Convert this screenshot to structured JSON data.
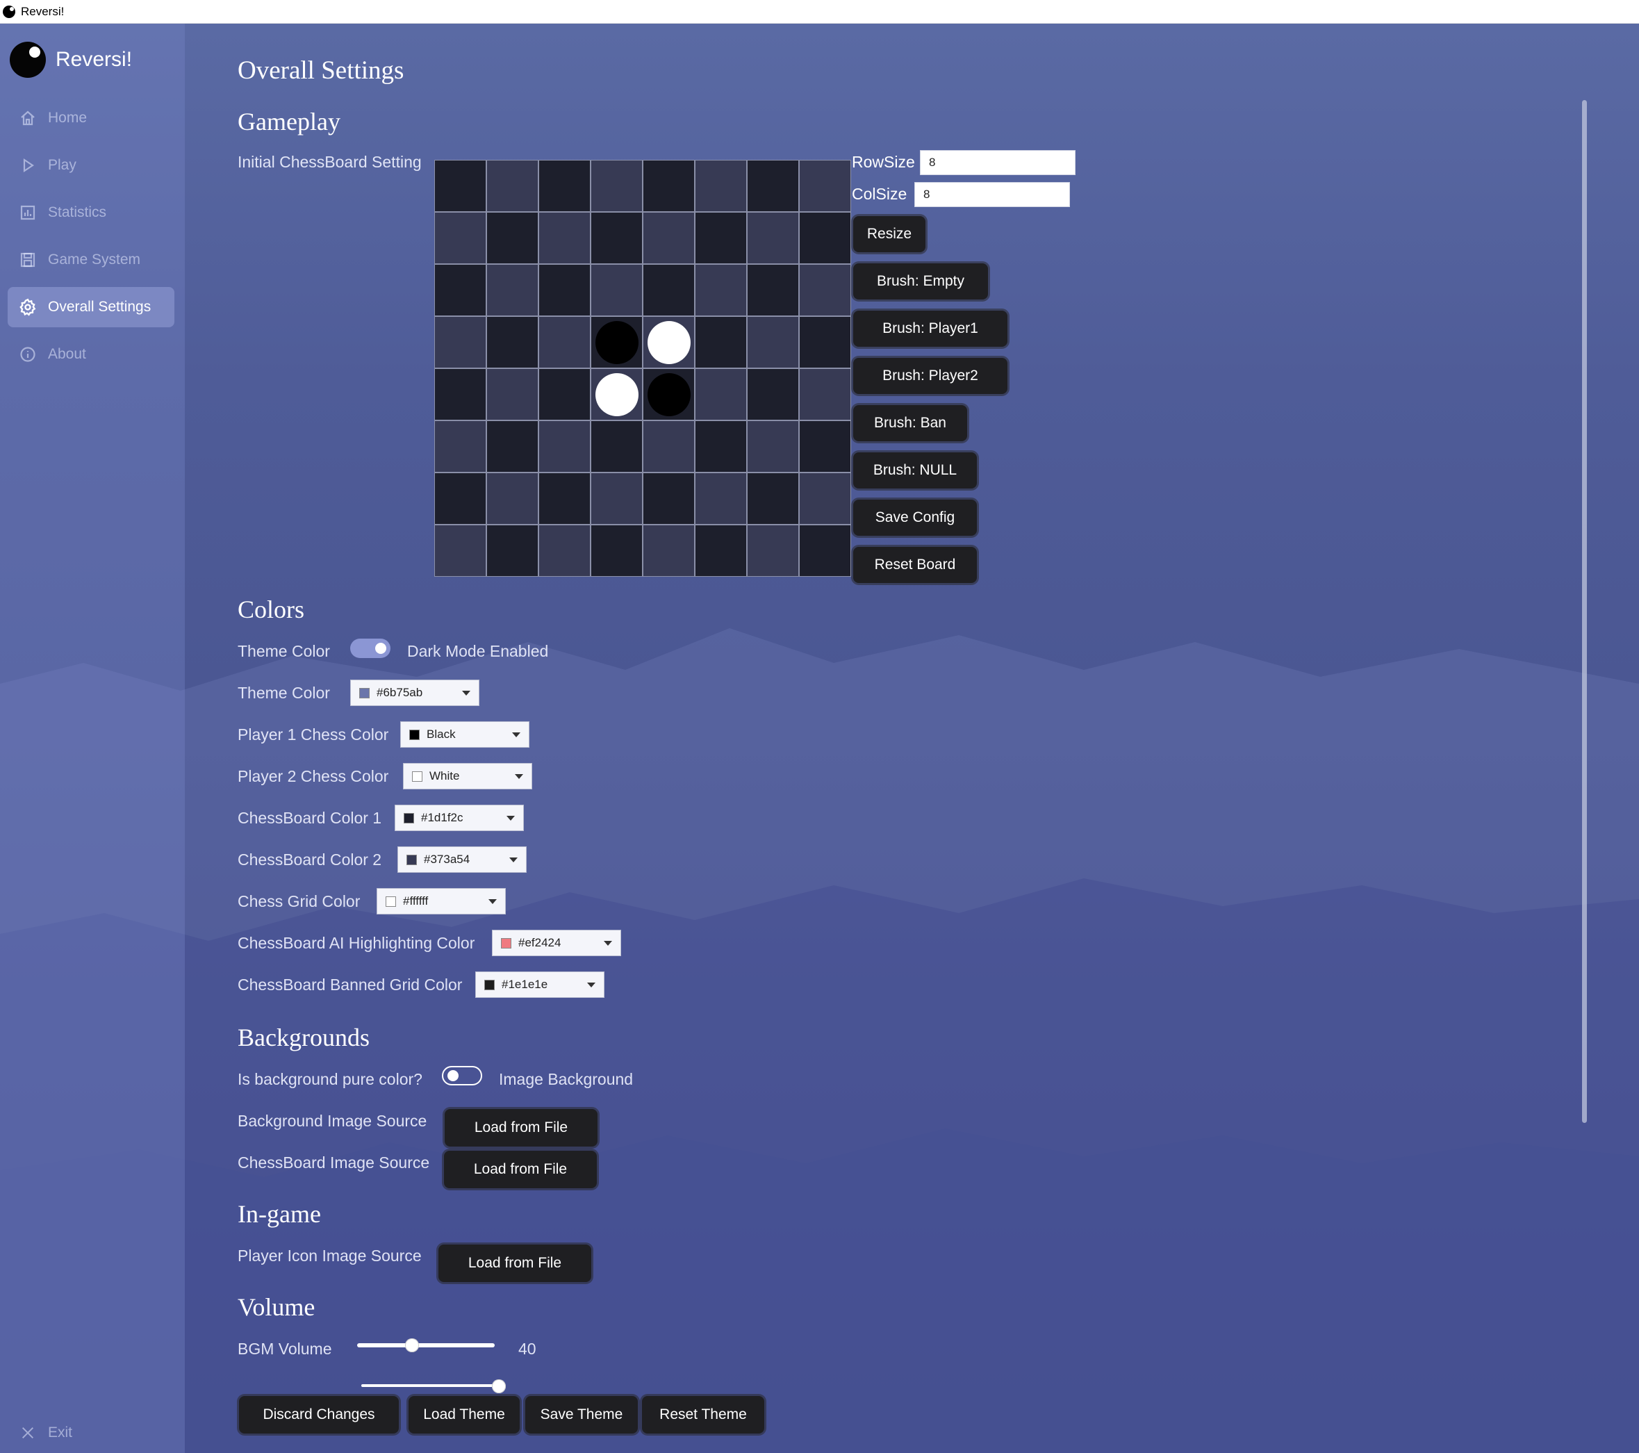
{
  "window": {
    "title": "Reversi!"
  },
  "brand": {
    "name": "Reversi!"
  },
  "sidebar": {
    "items": [
      {
        "label": "Home",
        "icon": "home-icon"
      },
      {
        "label": "Play",
        "icon": "play-icon"
      },
      {
        "label": "Statistics",
        "icon": "chart-icon"
      },
      {
        "label": "Game System",
        "icon": "save-icon"
      },
      {
        "label": "Overall Settings",
        "icon": "gear-icon",
        "active": true
      },
      {
        "label": "About",
        "icon": "info-icon"
      }
    ],
    "exit_label": "Exit"
  },
  "page": {
    "title": "Overall Settings"
  },
  "gameplay": {
    "heading": "Gameplay",
    "board_label": "Initial ChessBoard Setting",
    "row_size_label": "RowSize",
    "row_size_value": "8",
    "col_size_label": "ColSize",
    "col_size_value": "8",
    "buttons": {
      "resize": "Resize",
      "brush_empty": "Brush: Empty",
      "brush_player1": "Brush: Player1",
      "brush_player2": "Brush: Player2",
      "brush_ban": "Brush: Ban",
      "brush_null": "Brush: NULL",
      "save_config": "Save Config",
      "reset_board": "Reset Board"
    },
    "board": {
      "rows": 8,
      "cols": 8,
      "color1": "#1d1f2c",
      "color2": "#373a54",
      "pieces": [
        {
          "row": 3,
          "col": 3,
          "player": 1
        },
        {
          "row": 3,
          "col": 4,
          "player": 2
        },
        {
          "row": 4,
          "col": 3,
          "player": 2
        },
        {
          "row": 4,
          "col": 4,
          "player": 1
        }
      ]
    }
  },
  "colors": {
    "heading": "Colors",
    "theme_toggle_label": "Theme Color",
    "theme_toggle_state": "Dark Mode Enabled",
    "theme_toggle_on": true,
    "rows": [
      {
        "label": "Theme Color",
        "value": "#6b75ab",
        "swatch": "#6b75ab"
      },
      {
        "label": "Player 1 Chess Color",
        "value": "Black",
        "swatch": "#000000"
      },
      {
        "label": "Player 2 Chess Color",
        "value": "White",
        "swatch": "#ffffff"
      },
      {
        "label": "ChessBoard Color 1",
        "value": "#1d1f2c",
        "swatch": "#1d1f2c"
      },
      {
        "label": "ChessBoard Color 2",
        "value": "#373a54",
        "swatch": "#373a54"
      },
      {
        "label": "Chess Grid Color",
        "value": "#ffffff",
        "swatch": "#ffffff"
      },
      {
        "label": "ChessBoard AI Highlighting Color",
        "value": "#ef2424",
        "swatch": "#ef7a80"
      },
      {
        "label": "ChessBoard Banned Grid Color",
        "value": "#1e1e1e",
        "swatch": "#1e1e1e"
      }
    ]
  },
  "backgrounds": {
    "heading": "Backgrounds",
    "pure_color_label": "Is background pure color?",
    "pure_color_state": "Image Background",
    "pure_color_on": false,
    "bg_image_label": "Background Image Source",
    "bg_image_button": "Load from File",
    "board_image_label": "ChessBoard Image Source",
    "board_image_button": "Load from File"
  },
  "ingame": {
    "heading": "In-game",
    "player_icon_label": "Player Icon Image Source",
    "player_icon_button": "Load from File"
  },
  "volume": {
    "heading": "Volume",
    "bgm_label": "BGM Volume",
    "bgm_value": "40",
    "bgm_level": 0.4,
    "effect_level": 1.0
  },
  "footer": {
    "discard": "Discard Changes",
    "load_theme": "Load Theme",
    "save_theme": "Save Theme",
    "reset_theme": "Reset Theme"
  },
  "theme": {
    "accent": "#6b75ab",
    "button_bg": "#1f1f22"
  }
}
